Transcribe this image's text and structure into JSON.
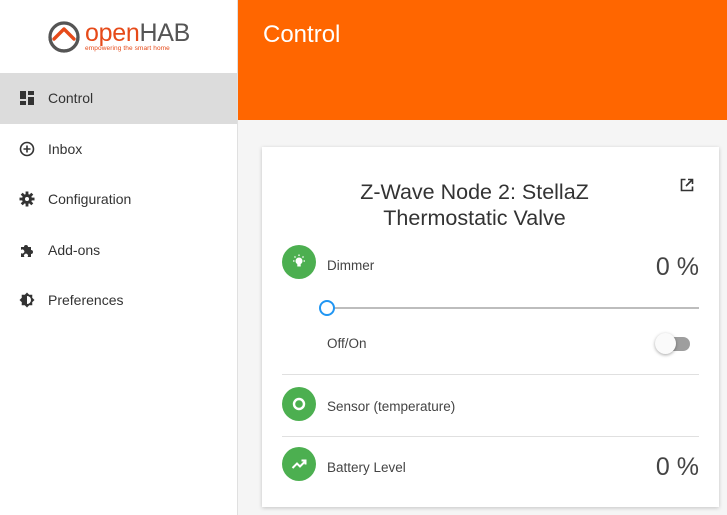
{
  "logo": {
    "main_open": "open",
    "main_hab": "HAB",
    "tagline": "empowering the smart home"
  },
  "sidebar": {
    "items": [
      {
        "label": "Control",
        "icon": "dashboard-icon",
        "active": true
      },
      {
        "label": "Inbox",
        "icon": "add-circle-icon",
        "active": false
      },
      {
        "label": "Configuration",
        "icon": "gear-icon",
        "active": false
      },
      {
        "label": "Add-ons",
        "icon": "puzzle-icon",
        "active": false
      },
      {
        "label": "Preferences",
        "icon": "brightness-icon",
        "active": false
      }
    ]
  },
  "header": {
    "title": "Control",
    "color": "#ff6600"
  },
  "card": {
    "title": "Z-Wave Node 2: StellaZ Thermostatic Valve",
    "rows": {
      "dimmer": {
        "label": "Dimmer",
        "value": "0 %",
        "slider_value": 0
      },
      "switch": {
        "label": "Off/On",
        "state": "off"
      },
      "sensor": {
        "label": "Sensor (temperature)"
      },
      "battery": {
        "label": "Battery Level",
        "value": "0 %"
      }
    }
  },
  "colors": {
    "accent": "#ff6600",
    "icon_bg": "#4caf50",
    "slider": "#2196f3"
  }
}
